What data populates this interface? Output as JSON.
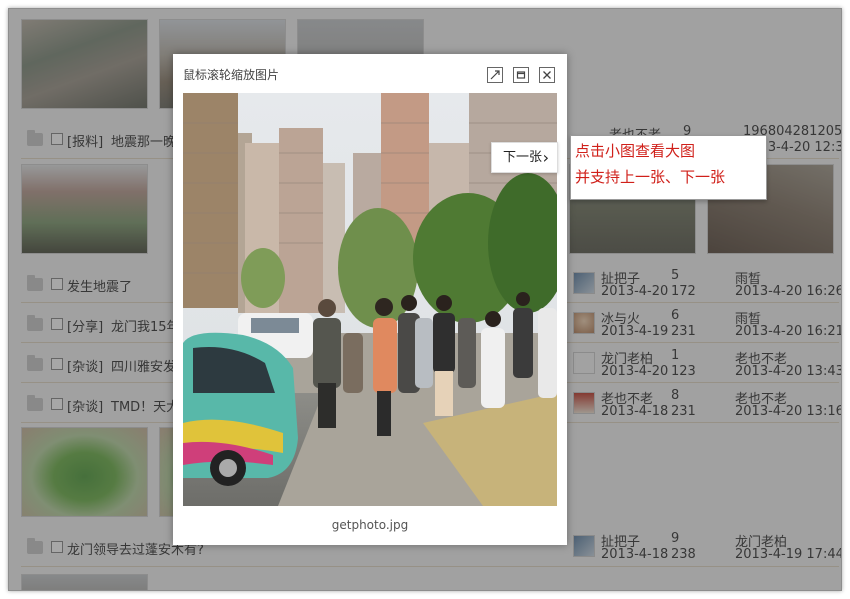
{
  "viewer": {
    "hint": "鼠标滚轮缩放图片",
    "filename": "getphoto.jpg",
    "next_label": "下一张",
    "next_arrow": "›",
    "icons": [
      "fullscreen-icon",
      "restore-window-icon",
      "close-icon"
    ]
  },
  "tooltip": {
    "line1": "点击小图查看大图",
    "line2": "并支持上一张、下一张"
  },
  "background_rows": [
    {
      "tag": "[报料]",
      "title": "地震那一晚",
      "user": "老也不老",
      "date": "2013-4-20",
      "replies": "9",
      "views": "",
      "last_user": "196804281205",
      "last_date": "2013-4-20 12:32"
    },
    {
      "tag": "",
      "title": "发生地震了",
      "user": "扯把子",
      "date": "2013-4-20",
      "replies": "5",
      "views": "172",
      "last_user": "雨晳",
      "last_date": "2013-4-20 16:26"
    },
    {
      "tag": "[分享]",
      "title": "龙门我15年",
      "user": "冰与火",
      "date": "2013-4-19",
      "replies": "6",
      "views": "231",
      "last_user": "雨晳",
      "last_date": "2013-4-20 16:21"
    },
    {
      "tag": "[杂谈]",
      "title": "四川雅安发",
      "user": "龙门老柏",
      "date": "2013-4-20",
      "replies": "1",
      "views": "123",
      "last_user": "老也不老",
      "last_date": "2013-4-20 13:43"
    },
    {
      "tag": "[杂谈]",
      "title": "TMD！天大",
      "user": "老也不老",
      "date": "2013-4-18",
      "replies": "8",
      "views": "231",
      "last_user": "老也不老",
      "last_date": "2013-4-20 13:16"
    },
    {
      "tag": "",
      "title": "龙门领导去过蓬安木有?",
      "user": "扯把子",
      "date": "2013-4-18",
      "replies": "9",
      "views": "238",
      "last_user": "龙门老柏",
      "last_date": "2013-4-19 17:44"
    }
  ],
  "colors": {
    "tooltip_text": "#d0201a",
    "tag": "#2b5ea8",
    "reply_count": "#c0392b"
  }
}
